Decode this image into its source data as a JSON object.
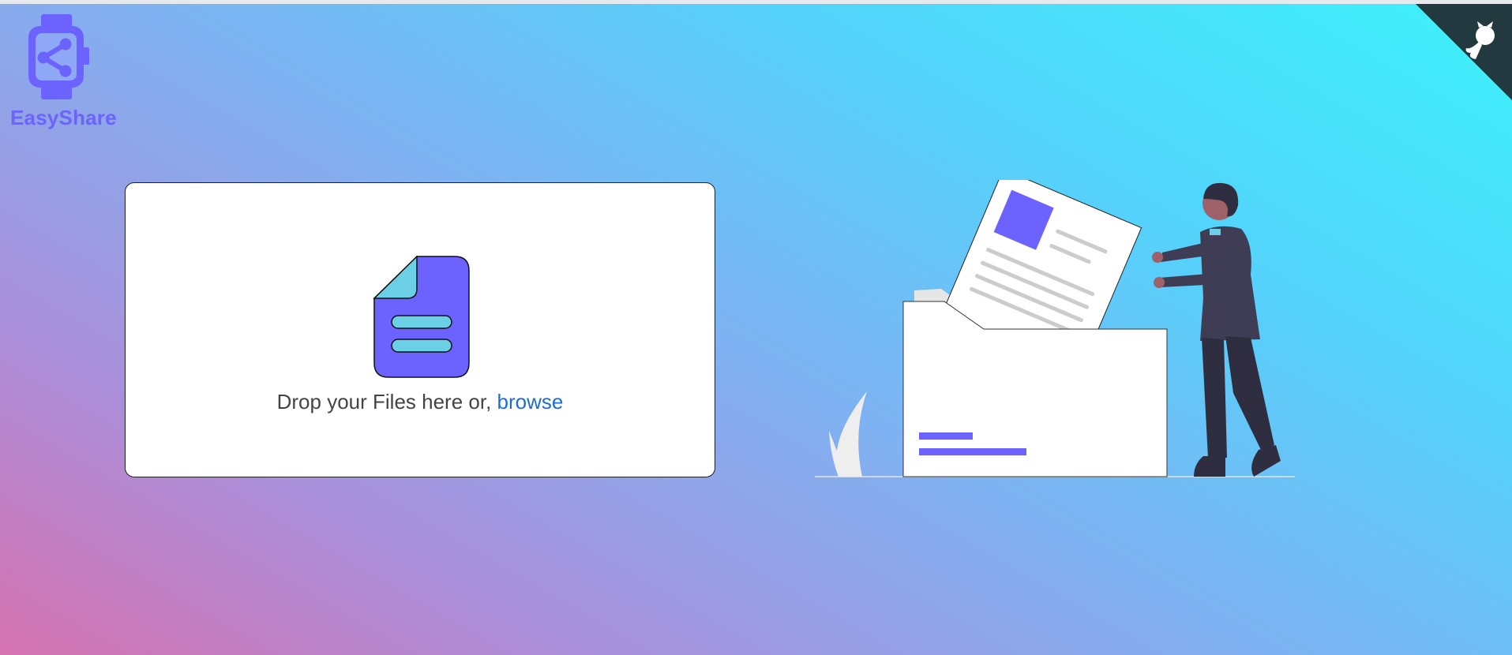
{
  "app": {
    "name": "EasyShare"
  },
  "upload": {
    "prompt": "Drop your Files here or,",
    "browse_label": "browse"
  },
  "icons": {
    "logo": "smartwatch-share-icon",
    "github": "github-octocat-icon",
    "file": "document-icon",
    "illustration": "person-filing-documents-illustration"
  },
  "colors": {
    "accent": "#6c63ff",
    "link": "#1a6fd6",
    "cyan": "#6bcfe6",
    "corner": "#223a3f"
  }
}
